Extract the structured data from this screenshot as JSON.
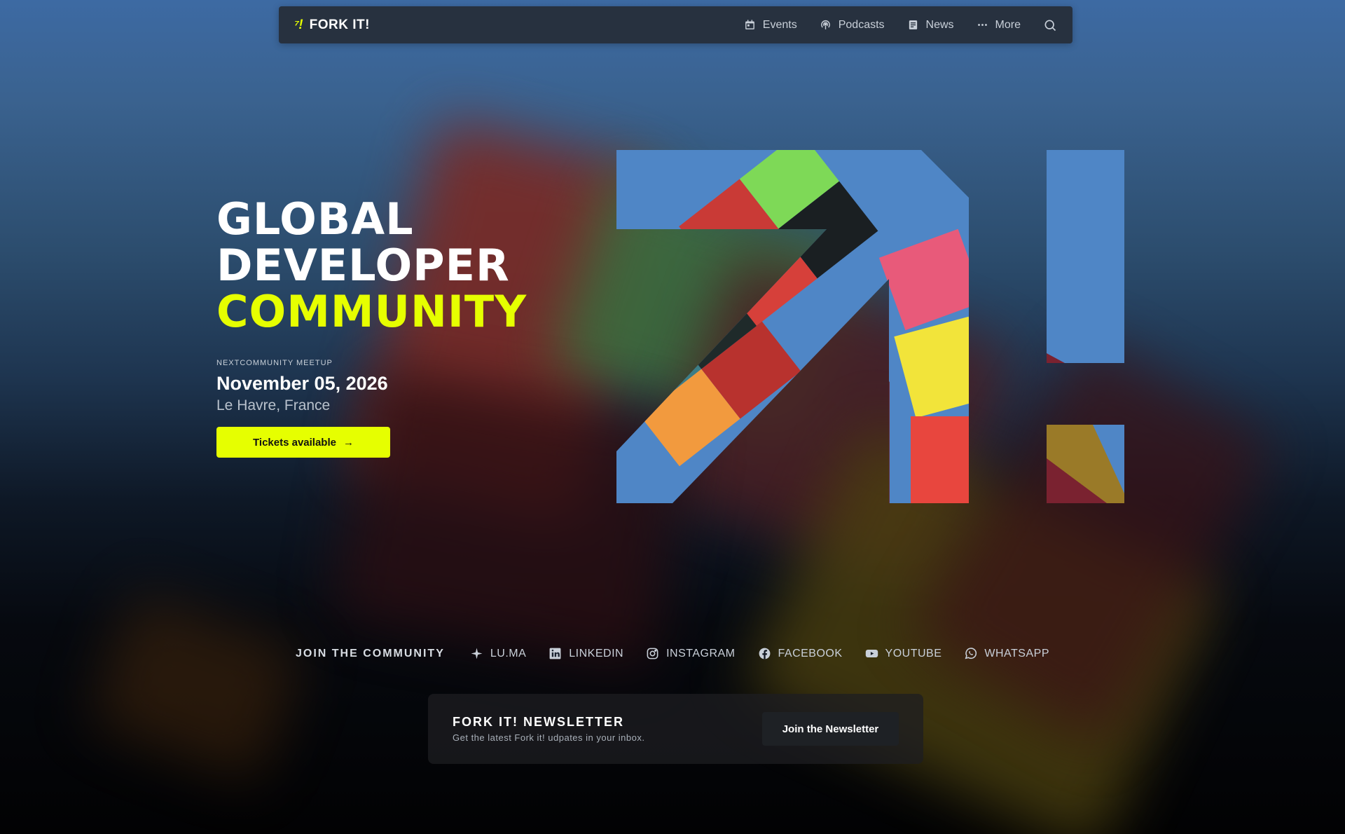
{
  "brand": {
    "mark": "⁷!",
    "name": "FORK IT!",
    "accent_color": "#e6ff00"
  },
  "nav": {
    "links": [
      {
        "label": "Events",
        "icon": "calendar-icon"
      },
      {
        "label": "Podcasts",
        "icon": "podcast-icon"
      },
      {
        "label": "News",
        "icon": "news-icon"
      },
      {
        "label": "More",
        "icon": "dots-icon"
      }
    ],
    "search_icon": "search-icon"
  },
  "hero": {
    "title_line1": "GLOBAL",
    "title_line2": "DEVELOPER",
    "title_line3": "COMMUNITY",
    "kicker": "NEXTCOMMUNITY MEETUP",
    "date": "November 05, 2026",
    "location": "Le Havre, France",
    "cta_label": "Tickets available",
    "cta_arrow": "→"
  },
  "community": {
    "title": "JOIN THE COMMUNITY",
    "links": [
      {
        "label": "LU.MA",
        "icon": "sparkle-icon"
      },
      {
        "label": "LINKEDIN",
        "icon": "linkedin-icon"
      },
      {
        "label": "INSTAGRAM",
        "icon": "instagram-icon"
      },
      {
        "label": "FACEBOOK",
        "icon": "facebook-icon"
      },
      {
        "label": "YOUTUBE",
        "icon": "youtube-icon"
      },
      {
        "label": "WHATSAPP",
        "icon": "whatsapp-icon"
      }
    ]
  },
  "newsletter": {
    "title": "FORK IT! NEWSLETTER",
    "subtitle": "Get the latest Fork it! udpates in your inbox.",
    "button": "Join the Newsletter"
  }
}
